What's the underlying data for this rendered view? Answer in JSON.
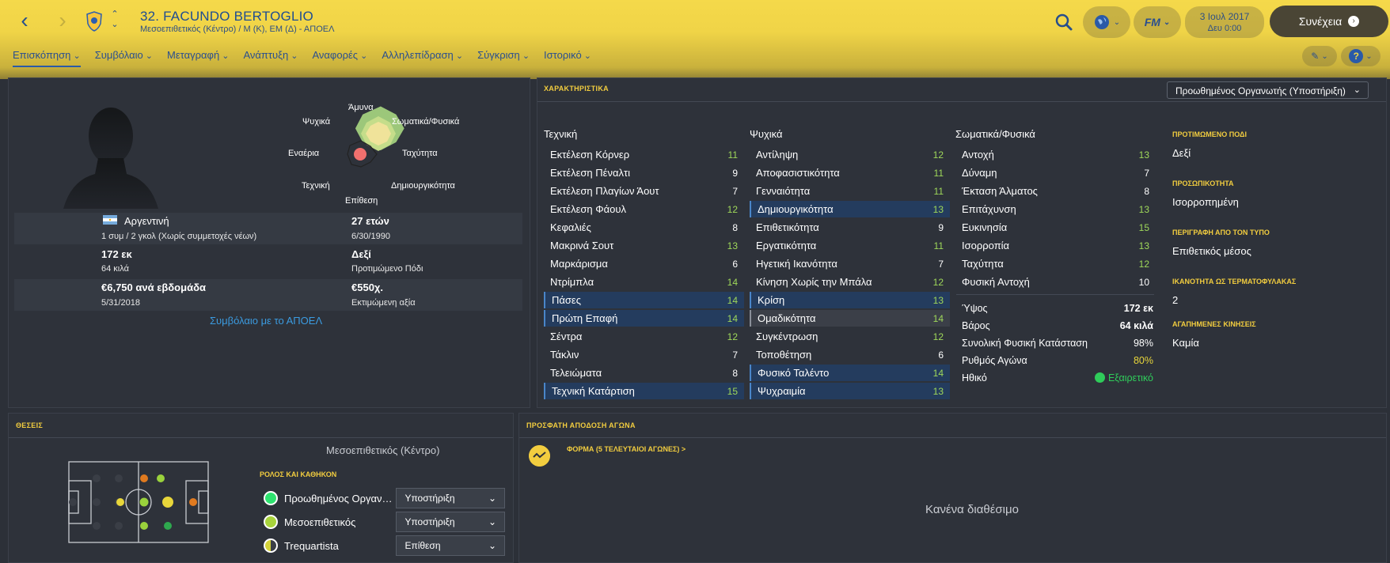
{
  "header": {
    "title": "32. FACUNDO BERTOGLIO",
    "subtitle": "Μεσοεπιθετικός (Κέντρο) / Μ (Κ), ΕΜ (Δ) - ΑΠΟΕΛ",
    "date_line1": "3 Ιουλ 2017",
    "date_line2": "Δευ 0:00",
    "continue_label": "Συνέχεια",
    "fm_label": "FM",
    "brand_color": "#f0d447"
  },
  "tabs": [
    {
      "label": "Επισκόπηση"
    },
    {
      "label": "Συμβόλαιο"
    },
    {
      "label": "Μεταγραφή"
    },
    {
      "label": "Ανάπτυξη"
    },
    {
      "label": "Αναφορές"
    },
    {
      "label": "Αλληλεπίδραση"
    },
    {
      "label": "Σύγκριση"
    },
    {
      "label": "Ιστορικό"
    }
  ],
  "profile": {
    "radar_labels": {
      "top": "Άμυνα",
      "top_right": "Σωματικά/Φυσικά",
      "right": "Ταχύτητα",
      "bottom_right": "Δημιουργικότητα",
      "bottom": "Επίθεση",
      "bottom_left": "Τεχνική",
      "left": "Εναέρια",
      "top_left": "Ψυχικά"
    },
    "nationality": "Αργεντινή",
    "caps": "1 συμ / 2 γκολ (Χωρίς συμμετοχές νέων)",
    "age": "27 ετών",
    "dob": "6/30/1990",
    "height": "172 εκ",
    "weight": "64 κιλά",
    "foot": "Δεξί",
    "foot_label": "Προτιμώμενο Πόδι",
    "wage": "€6,750 ανά εβδομάδα",
    "contract_end": "5/31/2018",
    "value": "€550χ.",
    "value_label": "Εκτιμώμενη αξία",
    "contract_link": "Συμβόλαιο με το ΑΠΟΕΛ"
  },
  "attributes": {
    "title": "ΧΑΡΑΚΤΗΡΙΣΤΙΚΑ",
    "role_select": "Προωθημένος Οργανωτής (Υποστήριξη)",
    "technical_title": "Τεχνική",
    "mental_title": "Ψυχικά",
    "physical_title": "Σωματικά/Φυσικά",
    "technical": [
      {
        "name": "Εκτέλεση Κόρνερ",
        "value": "11"
      },
      {
        "name": "Εκτέλεση Πέναλτι",
        "value": "9"
      },
      {
        "name": "Εκτέλεση Πλαγίων Άουτ",
        "value": "7"
      },
      {
        "name": "Εκτέλεση Φάουλ",
        "value": "12"
      },
      {
        "name": "Κεφαλιές",
        "value": "8"
      },
      {
        "name": "Μακρινά Σουτ",
        "value": "13"
      },
      {
        "name": "Μαρκάρισμα",
        "value": "6"
      },
      {
        "name": "Ντρίμπλα",
        "value": "14"
      },
      {
        "name": "Πάσες",
        "value": "14"
      },
      {
        "name": "Πρώτη Επαφή",
        "value": "14"
      },
      {
        "name": "Σέντρα",
        "value": "12"
      },
      {
        "name": "Τάκλιν",
        "value": "7"
      },
      {
        "name": "Τελειώματα",
        "value": "8"
      },
      {
        "name": "Τεχνική Κατάρτιση",
        "value": "15"
      }
    ],
    "mental": [
      {
        "name": "Αντίληψη",
        "value": "12"
      },
      {
        "name": "Αποφασιστικότητα",
        "value": "11"
      },
      {
        "name": "Γενναιότητα",
        "value": "11"
      },
      {
        "name": "Δημιουργικότητα",
        "value": "13"
      },
      {
        "name": "Επιθετικότητα",
        "value": "9"
      },
      {
        "name": "Εργατικότητα",
        "value": "11"
      },
      {
        "name": "Ηγετική Ικανότητα",
        "value": "7"
      },
      {
        "name": "Κίνηση Χωρίς την Μπάλα",
        "value": "12"
      },
      {
        "name": "Κρίση",
        "value": "13"
      },
      {
        "name": "Ομαδικότητα",
        "value": "14"
      },
      {
        "name": "Συγκέντρωση",
        "value": "12"
      },
      {
        "name": "Τοποθέτηση",
        "value": "6"
      },
      {
        "name": "Φυσικό Ταλέντο",
        "value": "14"
      },
      {
        "name": "Ψυχραιμία",
        "value": "13"
      }
    ],
    "physical": [
      {
        "name": "Αντοχή",
        "value": "13"
      },
      {
        "name": "Δύναμη",
        "value": "7"
      },
      {
        "name": "Έκταση Άλματος",
        "value": "8"
      },
      {
        "name": "Επιτάχυνση",
        "value": "13"
      },
      {
        "name": "Ευκινησία",
        "value": "15"
      },
      {
        "name": "Ισορροπία",
        "value": "13"
      },
      {
        "name": "Ταχύτητα",
        "value": "12"
      },
      {
        "name": "Φυσική Αντοχή",
        "value": "10"
      }
    ],
    "physical_info": [
      {
        "name": "Ύψος",
        "value": "172 εκ"
      },
      {
        "name": "Βάρος",
        "value": "64 κιλά"
      },
      {
        "name": "Συνολική Φυσική Κατάσταση",
        "value": "98%"
      },
      {
        "name": "Ρυθμός Αγώνα",
        "value": "80%"
      },
      {
        "name": "Ηθικό",
        "value": "Εξαιρετικό"
      }
    ],
    "side": [
      {
        "title": "ΠΡΟΤΙΜΩΜΕΝΟ ΠΟΔΙ",
        "value": "Δεξί"
      },
      {
        "title": "ΠΡΟΣΩΠΙΚΟΤΗΤΑ",
        "value": "Ισορροπημένη"
      },
      {
        "title": "ΠΕΡΙΓΡΑΦΗ ΑΠΟ ΤΟΝ ΤΥΠΟ",
        "value": "Επιθετικός μέσος"
      },
      {
        "title": "ΙΚΑΝΟΤΗΤΑ ΩΣ ΤΕΡΜΑΤΟΦΥΛΑΚΑΣ",
        "value": "2"
      },
      {
        "title": "ΑΓΑΠΗΜΕΝΕΣ ΚΙΝΗΣΕΙΣ",
        "value": "Καμία"
      }
    ]
  },
  "positions": {
    "title": "ΘΕΣΕΙΣ",
    "position_name": "Μεσοεπιθετικός (Κέντρο)",
    "roles_title": "ΡΟΛΟΣ ΚΑΙ ΚΑΘΗΚΟΝ",
    "roles": [
      {
        "name": "Προωθημένος Οργανωτής (Υποστήριξη)",
        "duty": "Υποστήριξη",
        "color": "#2ee36f"
      },
      {
        "name": "Μεσοεπιθετικός",
        "duty": "Υποστήριξη",
        "color": "#a8d43c"
      },
      {
        "name": "Trequartista",
        "duty": "Επίθεση",
        "color": "#d4d33a"
      }
    ]
  },
  "performance": {
    "title": "ΠΡΟΣΦΑΤΗ ΑΠΟΔΟΣΗ ΑΓΩΝΑ",
    "form_link": "ΦΟΡΜΑ (5 ΤΕΛΕΥΤΑΙΟΙ ΑΓΩΝΕΣ) >",
    "empty": "Κανένα διαθέσιμο"
  }
}
